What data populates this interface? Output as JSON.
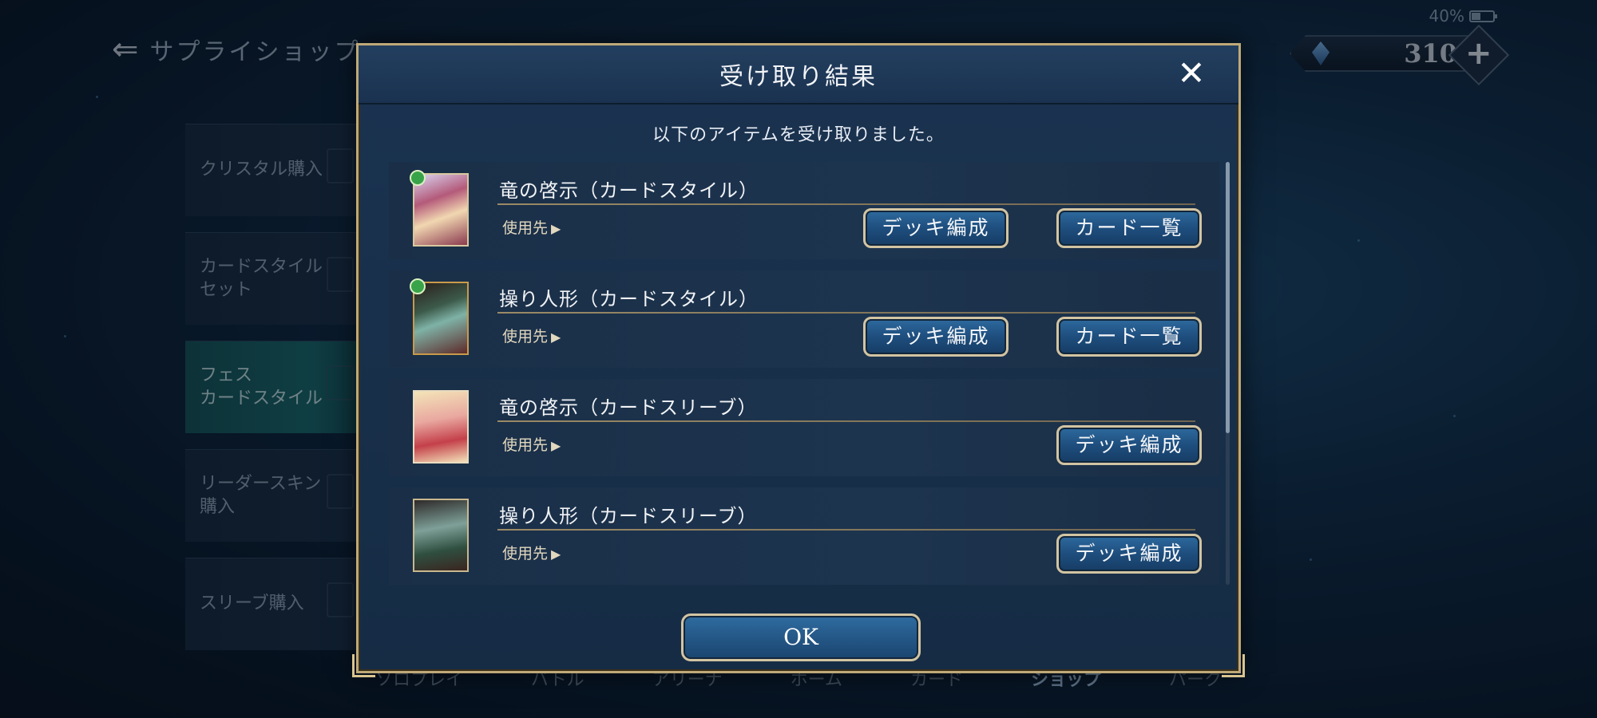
{
  "status_bar": {
    "battery_percent": "40%"
  },
  "background": {
    "title": "サプライショップ",
    "currency": {
      "icon": "crystal-icon",
      "amount": "310"
    },
    "side_menu": [
      {
        "label": "クリスタル購入"
      },
      {
        "label": "カードスタイル\nセット"
      },
      {
        "label": "フェス\nカードスタイル"
      },
      {
        "label": "リーダースキン\n購入"
      },
      {
        "label": "スリーブ購入"
      }
    ],
    "bottom_nav": [
      "ソロプレイ",
      "バトル",
      "アリーナ",
      "ホーム",
      "カード",
      "ショップ",
      "パーク"
    ]
  },
  "modal": {
    "title": "受け取り結果",
    "subtitle": "以下のアイテムを受け取りました。",
    "items": [
      {
        "name": "竜の啓示（カードスタイル）",
        "use_label": "使用先",
        "buttons": [
          "デッキ編成",
          "カード一覧"
        ]
      },
      {
        "name": "操り人形（カードスタイル）",
        "use_label": "使用先",
        "buttons": [
          "デッキ編成",
          "カード一覧"
        ]
      },
      {
        "name": "竜の啓示（カードスリーブ）",
        "use_label": "使用先",
        "buttons": [
          "デッキ編成"
        ]
      },
      {
        "name": "操り人形（カードスリーブ）",
        "use_label": "使用先",
        "buttons": [
          "デッキ編成"
        ]
      }
    ],
    "ok_label": "OK"
  },
  "colors": {
    "gold_border": "#bfa978",
    "button_blue": "#1e4e7e",
    "modal_bg": "#1a3350"
  }
}
